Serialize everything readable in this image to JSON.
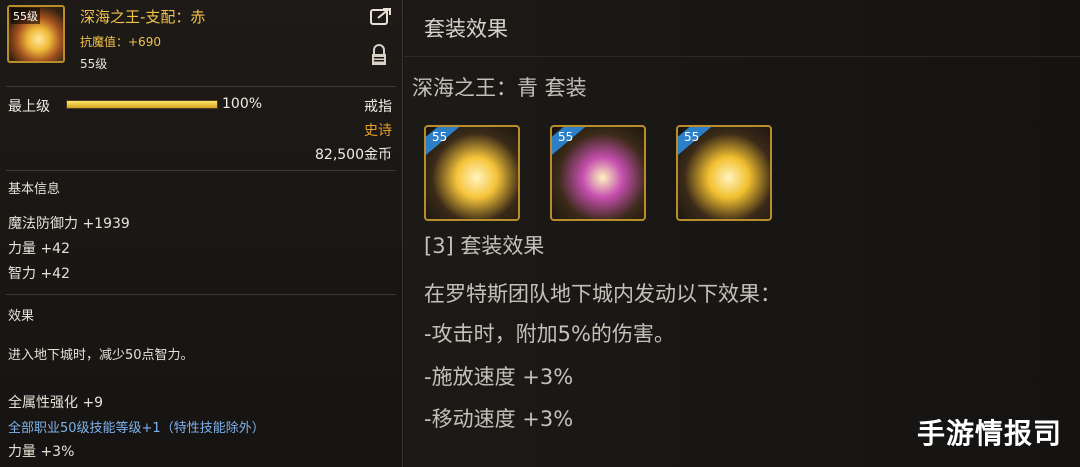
{
  "item": {
    "level_badge": "55级",
    "name": "深海之王-支配：赤",
    "resist_label": "抗魔值：+690",
    "level_text": "55级",
    "grade_label": "最上级",
    "grade_percent": 100,
    "grade_percent_text": "100%",
    "type": "戒指",
    "rarity": "史诗",
    "price": "82,500金币"
  },
  "basic": {
    "title": "基本信息",
    "stats": [
      "魔法防御力 +1939",
      "力量 +42",
      "智力 +42"
    ]
  },
  "effect": {
    "title": "效果",
    "desc": "进入地下城时，减少50点智力。",
    "extra": [
      "全属性强化 +9",
      "全部职业50级技能等级+1（特性技能除外）",
      "力量 +3%"
    ]
  },
  "set": {
    "header": "套装效果",
    "name": "深海之王：青  套装",
    "icons": [
      {
        "badge": "55",
        "color": "#f6c43a"
      },
      {
        "badge": "55",
        "color": "#c54fae"
      },
      {
        "badge": "55",
        "color": "#f2c030"
      }
    ],
    "count_title": "[3] 套装效果",
    "lines": [
      "在罗特斯团队地下城内发动以下效果：",
      "-攻击时，附加5%的伤害。",
      "-施放速度 +3%",
      "-移动速度 +3%"
    ]
  },
  "watermark": "手游情报司"
}
